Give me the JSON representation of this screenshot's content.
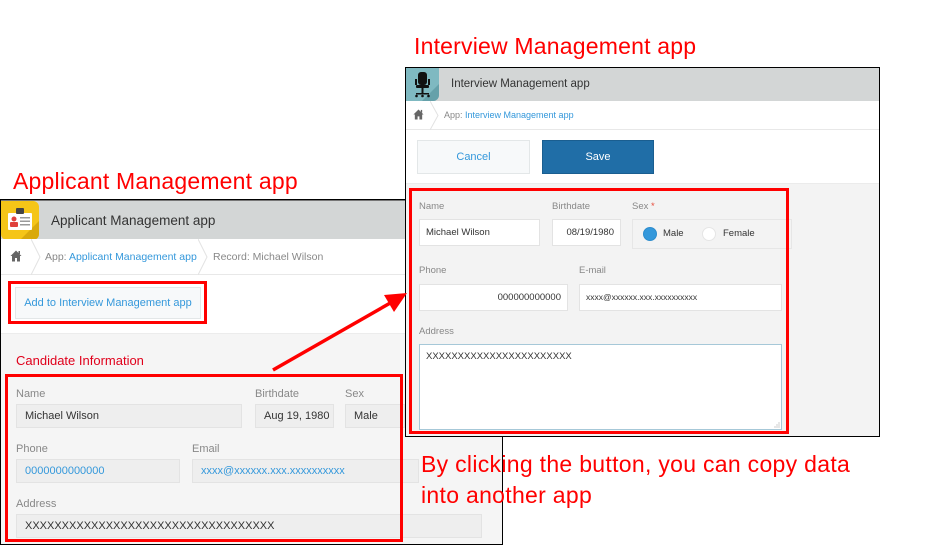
{
  "annotations": {
    "left_title": "Applicant Management app",
    "right_title": "Interview Management app",
    "caption_line1": "By clicking the button, you can copy data",
    "caption_line2": "into another app",
    "highlight_color": "#ff0000"
  },
  "applicant_app": {
    "app_name": "Applicant Management app",
    "app_icon": "id-badge-icon",
    "breadcrumb": {
      "home_icon": "home-icon",
      "app_prefix": "App: ",
      "app_link": "Applicant Management app",
      "record": "Record: Michael Wilson"
    },
    "toolbar": {
      "add_button_label": "Add to Interview Management app"
    },
    "section_title": "Candidate Information",
    "fields": {
      "name_label": "Name",
      "name_value": "Michael Wilson",
      "birthdate_label": "Birthdate",
      "birthdate_value": "Aug 19, 1980",
      "sex_label": "Sex",
      "sex_value": "Male",
      "phone_label": "Phone",
      "phone_value": "0000000000000",
      "email_label": "Email",
      "email_value": "xxxx@xxxxxx.xxx.xxxxxxxxxx",
      "address_label": "Address",
      "address_value": "XXXXXXXXXXXXXXXXXXXXXXXXXXXXXXXXXX"
    }
  },
  "interview_app": {
    "app_name": "Interview Management app",
    "app_icon": "office-chair-icon",
    "breadcrumb": {
      "home_icon": "home-icon",
      "app_prefix": "App: ",
      "app_link": "Interview Management app"
    },
    "toolbar": {
      "cancel_label": "Cancel",
      "save_label": "Save"
    },
    "form": {
      "name_label": "Name",
      "name_value": "Michael Wilson",
      "birthdate_label": "Birthdate",
      "birthdate_value": "08/19/1980",
      "sex_label": "Sex",
      "sex_required_mark": "*",
      "sex_options": [
        "Male",
        "Female"
      ],
      "sex_selected": "Male",
      "phone_label": "Phone",
      "phone_value": "000000000000",
      "email_label": "E-mail",
      "email_value": "xxxx@xxxxxx.xxx.xxxxxxxxxx",
      "address_label": "Address",
      "address_value": "XXXXXXXXXXXXXXXXXXXXXXX"
    }
  }
}
